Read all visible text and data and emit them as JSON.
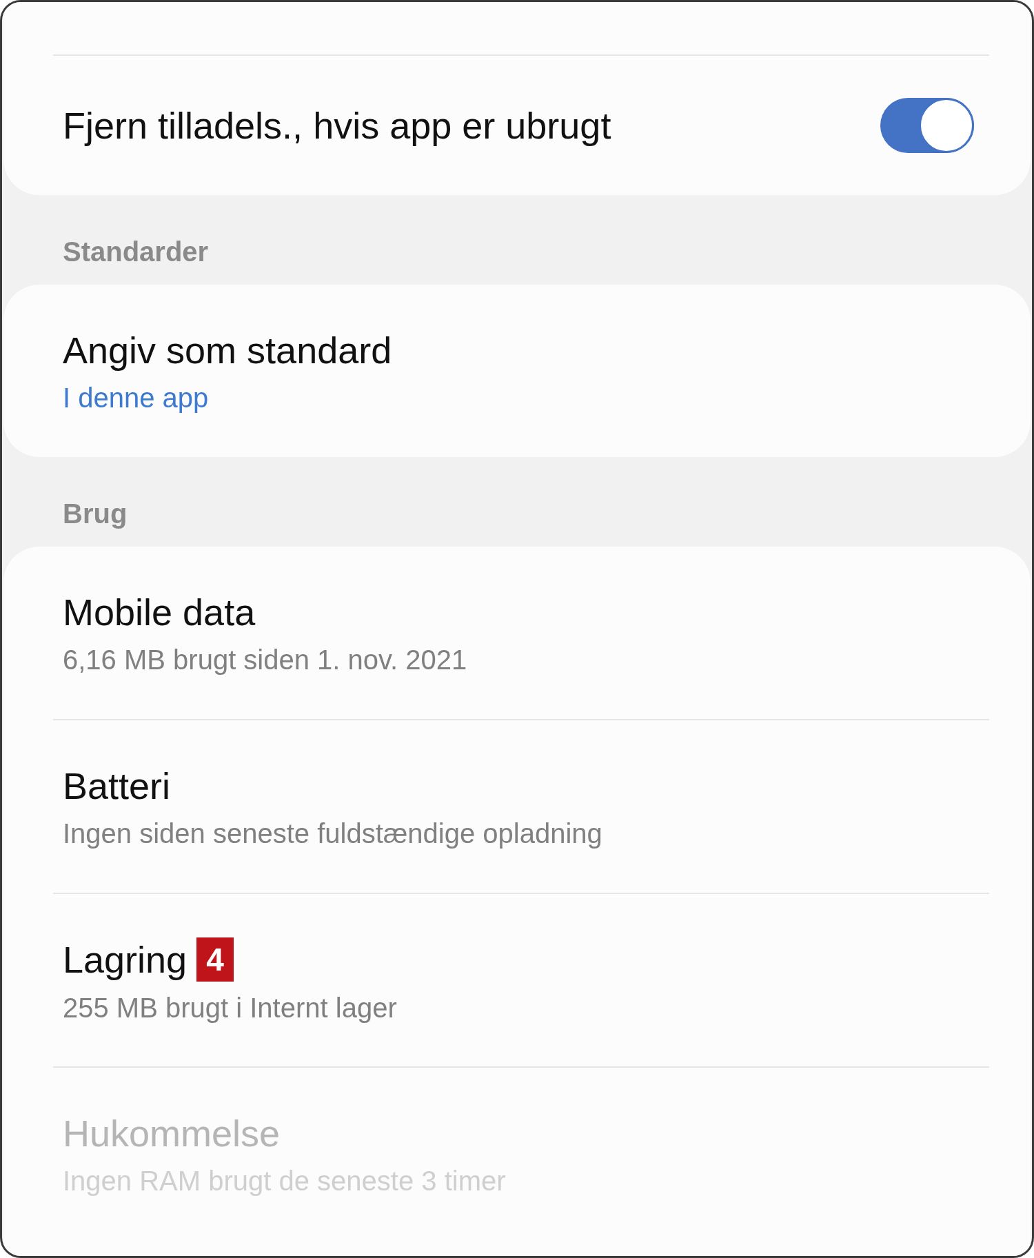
{
  "sections": [
    {
      "items": [
        {
          "kind": "toggle",
          "title": "Fjern tilladels., hvis app er ubrugt",
          "on": true,
          "disabled": false
        }
      ]
    },
    {
      "header": "Standarder",
      "items": [
        {
          "kind": "value",
          "title": "Angiv som standard",
          "subtitle": "I denne app",
          "disabled": false
        }
      ]
    },
    {
      "header": "Brug",
      "items": [
        {
          "kind": "plain",
          "title": "Mobile data",
          "subtitle": "6,16 MB brugt siden 1. nov. 2021",
          "disabled": false
        },
        {
          "kind": "plain",
          "title": "Batteri",
          "subtitle": "Ingen siden seneste fuldstændige opladning",
          "disabled": false
        },
        {
          "kind": "plain",
          "title": "Lagring",
          "badge": "4",
          "subtitle": "255 MB brugt i Internt lager",
          "disabled": false
        },
        {
          "kind": "plain",
          "title": "Hukommelse",
          "subtitle": "Ingen RAM brugt de seneste 3 timer",
          "disabled": true
        }
      ]
    }
  ]
}
